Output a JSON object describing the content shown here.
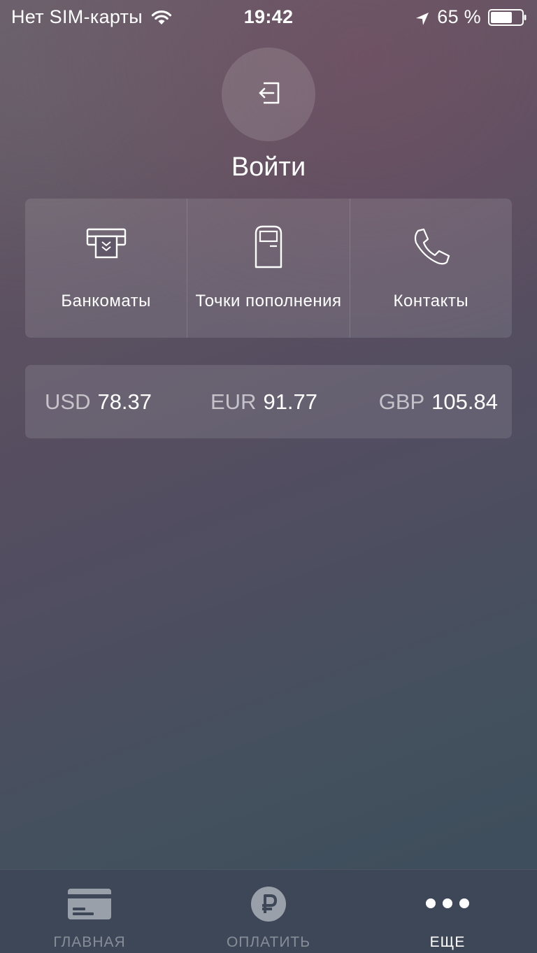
{
  "status_bar": {
    "carrier": "Нет SIM-карты",
    "time": "19:42",
    "battery": "65 %",
    "icons": [
      "wifi-icon",
      "location-arrow-icon",
      "battery-icon"
    ]
  },
  "login": {
    "icon": "sign-in-icon",
    "label": "Войти"
  },
  "tiles": [
    {
      "icon": "atm-icon",
      "label": "Банкоматы"
    },
    {
      "icon": "kiosk-icon",
      "label": "Точки пополнения"
    },
    {
      "icon": "phone-icon",
      "label": "Контакты"
    }
  ],
  "rates": [
    {
      "code": "USD",
      "value": "78.37"
    },
    {
      "code": "EUR",
      "value": "91.77"
    },
    {
      "code": "GBP",
      "value": "105.84"
    }
  ],
  "tab_bar": {
    "tabs": [
      {
        "icon": "card-icon",
        "label": "ГЛАВНАЯ",
        "active": false
      },
      {
        "icon": "ruble-icon",
        "label": "ОПЛАТИТЬ",
        "active": false
      },
      {
        "icon": "more-dots-icon",
        "label": "ЕЩЕ",
        "active": true
      }
    ]
  },
  "colors": {
    "tab_bar_bg": "#3e4758",
    "inactive_tab": "#9aa0aa",
    "active_tab": "#ffffff"
  }
}
